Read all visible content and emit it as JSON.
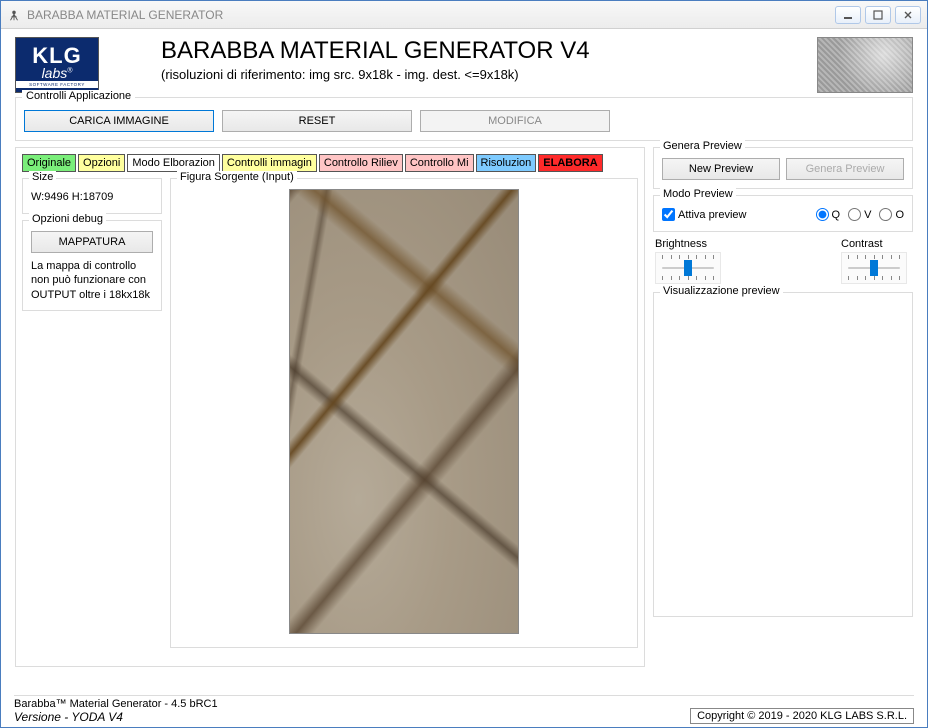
{
  "window": {
    "title": "BARABBA MATERIAL GENERATOR"
  },
  "logo": {
    "klg": "KLG",
    "labs": "labs",
    "sub": "SOFTWARE FACTORY"
  },
  "header": {
    "title": "BARABBA MATERIAL GENERATOR V4",
    "subtitle": "(risoluzioni di riferimento: img src. 9x18k - img. dest. <=9x18k)"
  },
  "appControls": {
    "legend": "Controlli Applicazione",
    "load": "CARICA IMMAGINE",
    "reset": "RESET",
    "modify": "MODIFICA"
  },
  "tabs": [
    {
      "label": "Originale",
      "cls": "green"
    },
    {
      "label": "Opzioni",
      "cls": "yellow"
    },
    {
      "label": "Modo Elborazion",
      "cls": "white"
    },
    {
      "label": "Controlli immagin",
      "cls": "yellow"
    },
    {
      "label": "Controllo Riliev",
      "cls": "pink"
    },
    {
      "label": "Controllo Mi",
      "cls": "pink"
    },
    {
      "label": "Risoluzion",
      "cls": "blue"
    },
    {
      "label": "ELABORA",
      "cls": "red"
    }
  ],
  "size": {
    "legend": "Size",
    "value": "W:9496 H:18709"
  },
  "debug": {
    "legend": "Opzioni debug",
    "button": "MAPPATURA",
    "note": "La mappa di controllo non può funzionare con OUTPUT oltre i 18kx18k"
  },
  "imagePanel": {
    "legend": "Figura Sorgente (Input)"
  },
  "preview": {
    "legend": "Genera Preview",
    "newBtn": "New Preview",
    "genBtn": "Genera Preview"
  },
  "modoPreview": {
    "legend": "Modo Preview",
    "checkbox": "Attiva preview",
    "options": [
      "Q",
      "V",
      "O"
    ],
    "selected": "Q"
  },
  "brightness": "Brightness",
  "contrast": "Contrast",
  "viz": {
    "legend": "Visualizzazione preview"
  },
  "footer": {
    "line1": "Barabba™ Material Generator - 4.5 bRC1",
    "line2": "Versione -  YODA V4",
    "copyright": "Copyright © 2019 - 2020 KLG LABS S.R.L."
  }
}
